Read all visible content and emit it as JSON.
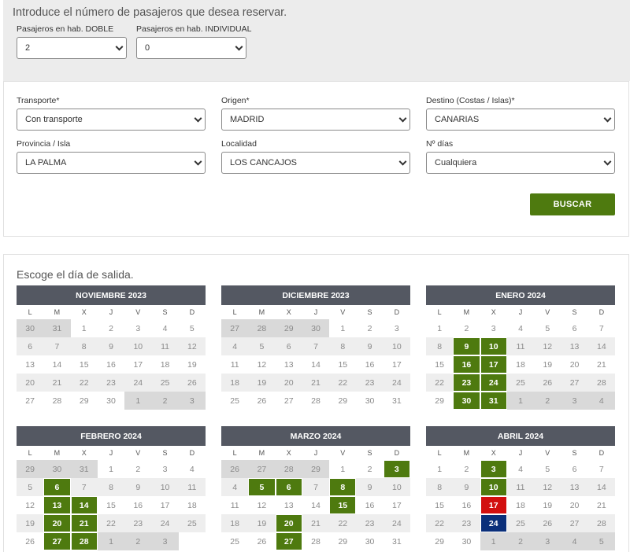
{
  "passengers": {
    "title": "Introduce el número de pasajeros que desea reservar.",
    "double_label": "Pasajeros en hab. DOBLE",
    "double_value": "2",
    "single_label": "Pasajeros en hab. INDIVIDUAL",
    "single_value": "0"
  },
  "filters": {
    "transporte_label": "Transporte*",
    "transporte_value": "Con transporte",
    "origen_label": "Origen*",
    "origen_value": "MADRID",
    "destino_label": "Destino (Costas / Islas)*",
    "destino_value": "CANARIAS",
    "provincia_label": "Provincia / Isla",
    "provincia_value": "LA PALMA",
    "localidad_label": "Localidad",
    "localidad_value": "LOS CANCAJOS",
    "dias_label": "Nº días",
    "dias_value": "Cualquiera",
    "search_label": "BUSCAR"
  },
  "calendar": {
    "title": "Escoge el día de salida.",
    "weekdays": [
      "L",
      "M",
      "X",
      "J",
      "V",
      "S",
      "D"
    ],
    "colors": {
      "available": "#4e7a0f",
      "selected_red": "#d20f0f",
      "selected_blue": "#0a2f7a"
    },
    "months": [
      {
        "name": "NOVIEMBRE 2023",
        "lead": [
          "30",
          "31"
        ],
        "days": 30,
        "trail": [
          "1",
          "2",
          "3"
        ],
        "green": [],
        "red": [],
        "blue": []
      },
      {
        "name": "DICIEMBRE 2023",
        "lead": [
          "27",
          "28",
          "29",
          "30"
        ],
        "days": 31,
        "trail": [],
        "green": [],
        "red": [],
        "blue": []
      },
      {
        "name": "ENERO 2024",
        "lead": [],
        "days": 31,
        "trail": [
          "1",
          "2",
          "3",
          "4"
        ],
        "green": [
          9,
          10,
          16,
          17,
          23,
          24,
          30,
          31
        ],
        "red": [],
        "blue": []
      },
      {
        "name": "FEBRERO 2024",
        "lead": [
          "29",
          "30",
          "31"
        ],
        "days": 28,
        "trail": [
          "1",
          "2",
          "3"
        ],
        "green": [
          6,
          13,
          14,
          20,
          21,
          27,
          28
        ],
        "red": [],
        "blue": []
      },
      {
        "name": "MARZO 2024",
        "lead": [
          "26",
          "27",
          "28",
          "29"
        ],
        "days": 31,
        "trail": [],
        "green": [
          3,
          5,
          6,
          8,
          15,
          20,
          27
        ],
        "red": [],
        "blue": []
      },
      {
        "name": "ABRIL 2024",
        "lead": [],
        "days": 30,
        "trail": [
          "1",
          "2",
          "3",
          "4",
          "5"
        ],
        "green": [
          3,
          10
        ],
        "red": [
          17
        ],
        "blue": [
          24
        ]
      }
    ]
  }
}
